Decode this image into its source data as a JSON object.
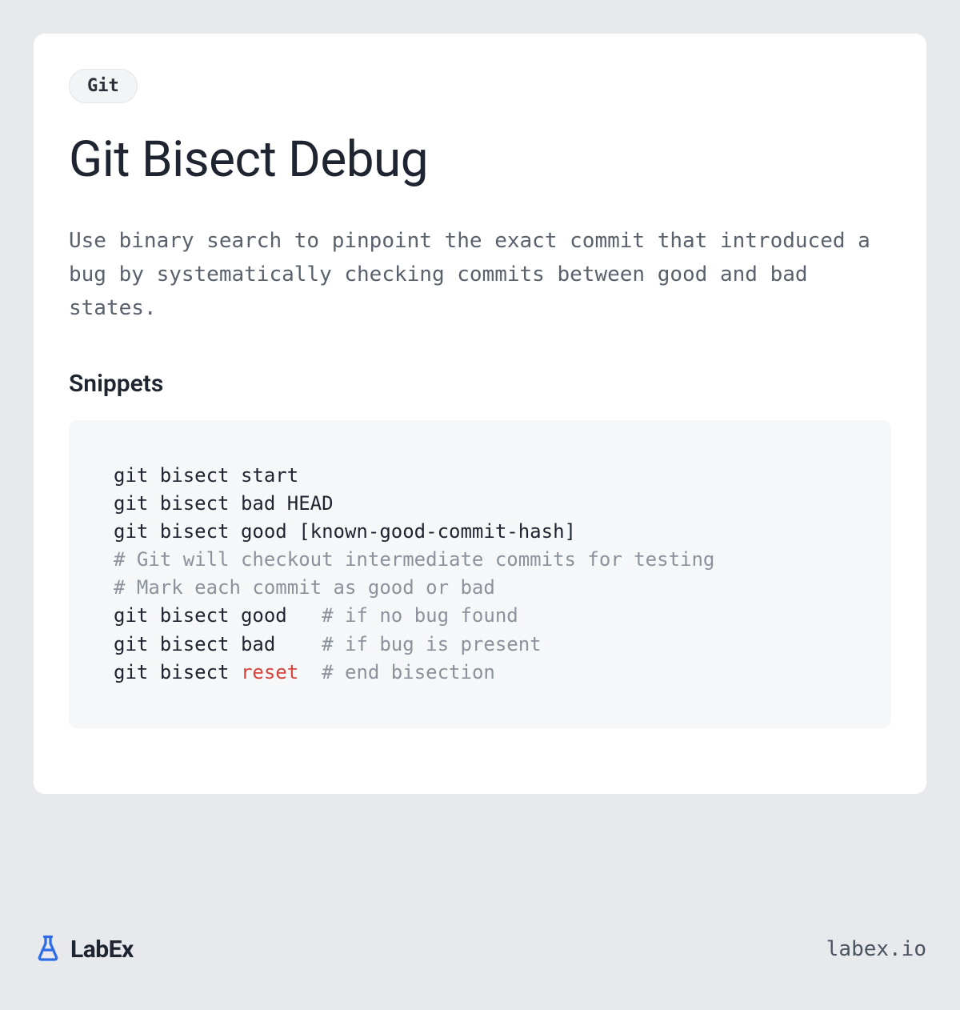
{
  "tag": "Git",
  "title": "Git Bisect Debug",
  "description": "Use binary search to pinpoint the exact commit that introduced a bug by systematically checking commits between good and bad states.",
  "snippets_heading": "Snippets",
  "code": {
    "lines": [
      {
        "segments": [
          {
            "text": "git bisect start",
            "cls": ""
          }
        ]
      },
      {
        "segments": [
          {
            "text": "git bisect bad HEAD",
            "cls": ""
          }
        ]
      },
      {
        "segments": [
          {
            "text": "git bisect good [known-good-commit-hash]",
            "cls": ""
          }
        ]
      },
      {
        "segments": [
          {
            "text": "# Git will checkout intermediate commits for testing",
            "cls": "comment"
          }
        ]
      },
      {
        "segments": [
          {
            "text": "# Mark each commit as good or bad",
            "cls": "comment"
          }
        ]
      },
      {
        "segments": [
          {
            "text": "git bisect good   ",
            "cls": ""
          },
          {
            "text": "# if no bug found",
            "cls": "comment"
          }
        ]
      },
      {
        "segments": [
          {
            "text": "git bisect bad    ",
            "cls": ""
          },
          {
            "text": "# if bug is present",
            "cls": "comment"
          }
        ]
      },
      {
        "segments": [
          {
            "text": "git bisect ",
            "cls": ""
          },
          {
            "text": "reset",
            "cls": "keyword"
          },
          {
            "text": "  ",
            "cls": ""
          },
          {
            "text": "# end bisection",
            "cls": "comment"
          }
        ]
      }
    ]
  },
  "footer": {
    "brand": "LabEx",
    "url": "labex.io"
  }
}
